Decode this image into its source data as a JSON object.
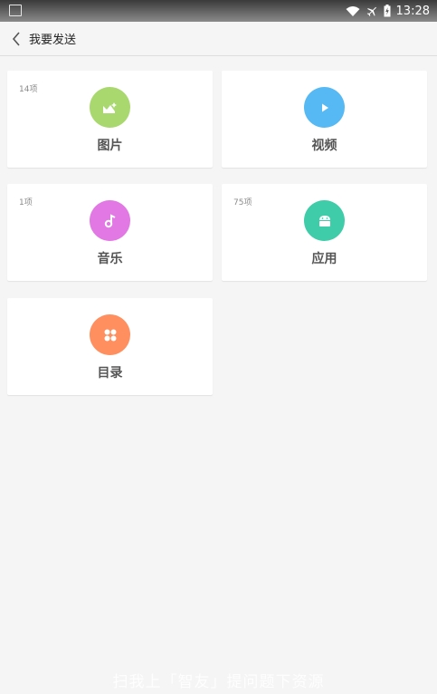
{
  "status_bar": {
    "time": "13:28",
    "icons": [
      "image-icon",
      "wifi-icon",
      "airplane-icon",
      "battery-charging-icon"
    ]
  },
  "header": {
    "title": "我要发送",
    "back_icon": "chevron-left-icon"
  },
  "cards": [
    {
      "label": "图片",
      "count": "14项",
      "icon": "image-icon",
      "color": "#a9d86e"
    },
    {
      "label": "视频",
      "count": "",
      "icon": "play-icon",
      "color": "#56b9f4"
    },
    {
      "label": "音乐",
      "count": "1项",
      "icon": "music-note-icon",
      "color": "#e278e4"
    },
    {
      "label": "应用",
      "count": "75项",
      "icon": "android-icon",
      "color": "#3fcca8"
    },
    {
      "label": "目录",
      "count": "",
      "icon": "grid-dots-icon",
      "color": "#ff8f5f"
    }
  ],
  "footer": {
    "watermark": "扫我上「智友」提问题下资源"
  }
}
